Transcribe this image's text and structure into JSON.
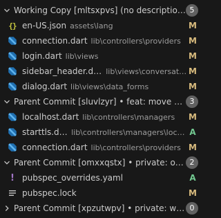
{
  "groups": [
    {
      "title": "Working Copy [mltsxpvs] (no description)",
      "count": "5",
      "expanded": true,
      "files": [
        {
          "name": "en-US.json",
          "path": "assets\\lang",
          "status": "M",
          "icon": "json-braces-icon"
        },
        {
          "name": "connection.dart",
          "path": "lib\\controllers\\providers",
          "status": "M",
          "icon": "dart-icon"
        },
        {
          "name": "login.dart",
          "path": "lib\\views",
          "status": "M",
          "icon": "dart-icon"
        },
        {
          "name": "sidebar_header.dart",
          "path": "lib\\views\\conversation",
          "status": "M",
          "icon": "dart-icon"
        },
        {
          "name": "dialog.dart",
          "path": "lib\\views\\data_forms",
          "status": "M",
          "icon": "dart-icon"
        }
      ]
    },
    {
      "title": "Parent Commit [sluvlzyr] • feat: move ch...",
      "count": "3",
      "expanded": true,
      "files": [
        {
          "name": "localhost.dart",
          "path": "lib\\controllers\\managers",
          "status": "M",
          "icon": "dart-icon"
        },
        {
          "name": "starttls.dart",
          "path": "lib\\controllers\\managers\\localh...",
          "status": "A",
          "icon": "dart-icon"
        },
        {
          "name": "connection.dart",
          "path": "lib\\controllers\\providers",
          "status": "M",
          "icon": "dart-icon"
        }
      ]
    },
    {
      "title": "Parent Commit [omxxqstx] • private: ove...",
      "count": "2",
      "expanded": true,
      "files": [
        {
          "name": "pubspec_overrides.yaml",
          "path": "",
          "status": "A",
          "icon": "yaml-exclamation-icon"
        },
        {
          "name": "pubspec.lock",
          "path": "",
          "status": "M",
          "icon": "lines-icon"
        }
      ]
    },
    {
      "title": "Parent Commit [xpzutwpv] • private: wip:...",
      "count": "0",
      "expanded": false,
      "files": []
    }
  ],
  "colors": {
    "background": "#181818",
    "modified": "#d7ba7d",
    "added": "#73c991",
    "badge": "#616161",
    "dart": "#4a9fd8"
  }
}
